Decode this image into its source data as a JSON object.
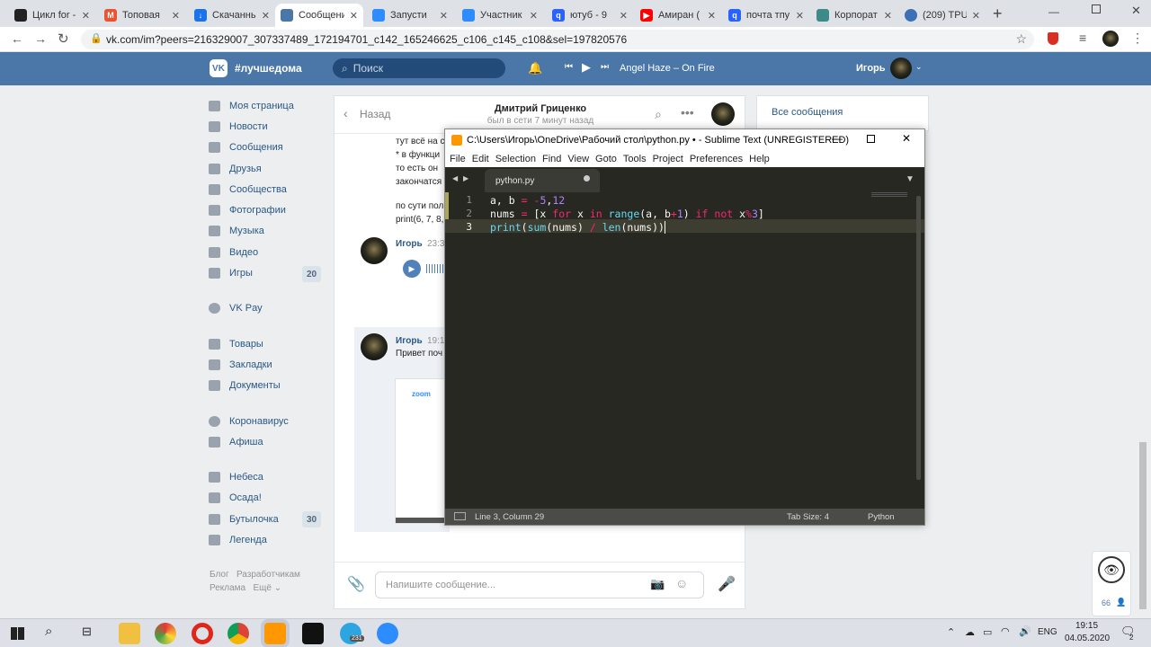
{
  "browser": {
    "tabs": [
      {
        "title": "Цикл for - ",
        "color": "#222"
      },
      {
        "title": "Топовая ",
        "color": "#e8542f"
      },
      {
        "title": "Скачанны",
        "color": "#1a73e8"
      },
      {
        "title": "Сообщени",
        "color": "#4a76a8"
      },
      {
        "title": "Запусти",
        "color": "#2d8cff"
      },
      {
        "title": "Участник",
        "color": "#2d8cff"
      },
      {
        "title": "ютуб - 9 ",
        "color": "#2962ff"
      },
      {
        "title": "Амиран (",
        "color": "#ff0000"
      },
      {
        "title": "почта тпу",
        "color": "#2962ff"
      },
      {
        "title": "Корпорат",
        "color": "#3d8b87"
      },
      {
        "title": "(209) TPU",
        "color": "#3b6fb6"
      }
    ],
    "url": "vk.com/im?peers=216329007_307337489_172194701_c142_165246625_c106_c145_c108&sel=197820576"
  },
  "vk": {
    "brand": "#лучшедома",
    "search_placeholder": "Поиск",
    "track": "Angel Haze – On Fire",
    "user": "Игорь",
    "menu": [
      {
        "label": "Моя страница"
      },
      {
        "label": "Новости"
      },
      {
        "label": "Сообщения"
      },
      {
        "label": "Друзья"
      },
      {
        "label": "Сообщества"
      },
      {
        "label": "Фотографии"
      },
      {
        "label": "Музыка"
      },
      {
        "label": "Видео"
      },
      {
        "label": "Игры",
        "badge": "20"
      },
      {
        "label": "VK Pay"
      },
      {
        "label": "Товары"
      },
      {
        "label": "Закладки"
      },
      {
        "label": "Документы"
      },
      {
        "label": "Коронавирус"
      },
      {
        "label": "Афиша"
      },
      {
        "label": "Небеса"
      },
      {
        "label": "Осада!"
      },
      {
        "label": "Бутылочка",
        "badge": "30"
      },
      {
        "label": "Легенда"
      }
    ],
    "footer": {
      "blog": "Блог",
      "dev": "Разработчикам",
      "ads": "Реклама",
      "more": "Ещё"
    },
    "chat": {
      "back": "Назад",
      "name": "Дмитрий Гриценко",
      "status": "был в сети 7 минут назад",
      "lines": [
        "тут всё на с",
        "* в функци",
        "то есть он ",
        "закончатся",
        "по сути пол",
        "print(6, 7, 8,"
      ],
      "msg1_author": "Игорь",
      "msg1_time": "23:3",
      "msg2_author": "Игорь",
      "msg2_time": "19:1",
      "msg2_text": "Привет поч",
      "zoom_label": "zoom",
      "input_placeholder": "Напишите сообщение..."
    },
    "right": {
      "all_messages": "Все сообщения"
    },
    "online_count": "66"
  },
  "sublime": {
    "title": "C:\\Users\\Игорь\\OneDrive\\Рабочий стол\\python.py • - Sublime Text (UNREGISTERED)",
    "menu": [
      "File",
      "Edit",
      "Selection",
      "Find",
      "View",
      "Goto",
      "Tools",
      "Project",
      "Preferences",
      "Help"
    ],
    "tab": "python.py",
    "line_numbers": [
      "1",
      "2",
      "3"
    ],
    "status_pos": "Line 3, Column 29",
    "status_tab": "Tab Size: 4",
    "status_syntax": "Python"
  },
  "taskbar": {
    "lang": "ENG",
    "time": "19:15",
    "date": "04.05.2020",
    "notif": "2",
    "telegram_badge": "231"
  }
}
